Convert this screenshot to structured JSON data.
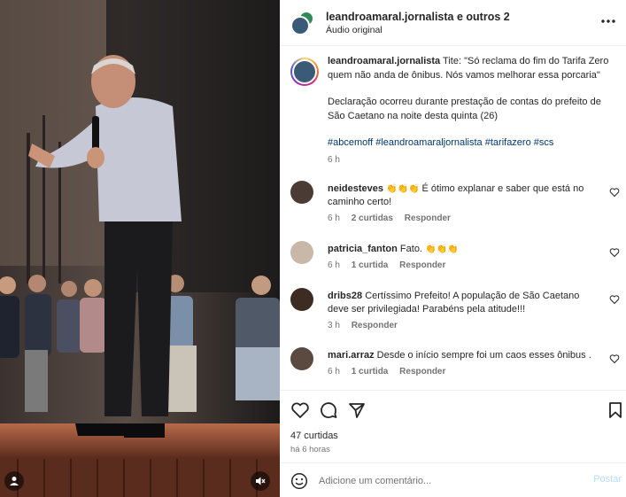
{
  "header": {
    "title": "leandroamaral.jornalista e outros 2",
    "subtitle": "Áudio original",
    "more_icon": "more-horizontal-icon"
  },
  "caption": {
    "username": "leandroamaral.jornalista",
    "text": "Tite: \"Só reclama do fim do Tarifa Zero quem não anda de ônibus. Nós vamos melhorar essa porcaria\"",
    "paragraph": "Declaração ocorreu durante prestação de contas do prefeito de São Caetano na noite desta quinta (26)",
    "hashtags": "#abcemoff #leandroamaraljornalista #tarifazero #scs",
    "time": "6 h"
  },
  "comments": [
    {
      "username": "neidesteves",
      "emoji": "👏👏👏",
      "text": "É ótimo explanar e saber que está no caminho certo!",
      "time": "6 h",
      "likes": "2 curtidas",
      "reply": "Responder",
      "avatar_color": "#4a3b35"
    },
    {
      "username": "patricia_fanton",
      "text": "Fato.",
      "emoji": "👏👏👏",
      "time": "6 h",
      "likes": "1 curtida",
      "reply": "Responder",
      "avatar_color": "#c9b7a8"
    },
    {
      "username": "dribs28",
      "text": "Certíssimo Prefeito! A população de São Caetano deve ser privilegiada! Parabéns pela atitude!!!",
      "time": "3 h",
      "likes": "",
      "reply": "Responder",
      "avatar_color": "#3d2c22"
    },
    {
      "username": "mari.arraz",
      "text": "Desde o início sempre foi um caos esses ônibus .",
      "time": "6 h",
      "likes": "1 curtida",
      "reply": "Responder",
      "avatar_color": "#5a4a40"
    }
  ],
  "actions": {
    "likes": "47 curtidas",
    "ago": "há 6 horas"
  },
  "add_comment": {
    "placeholder": "Adicione um comentário...",
    "post_label": "Postar"
  },
  "colors": {
    "link": "#00376b",
    "secondary": "#737373",
    "post_disabled": "#b3dbff"
  }
}
